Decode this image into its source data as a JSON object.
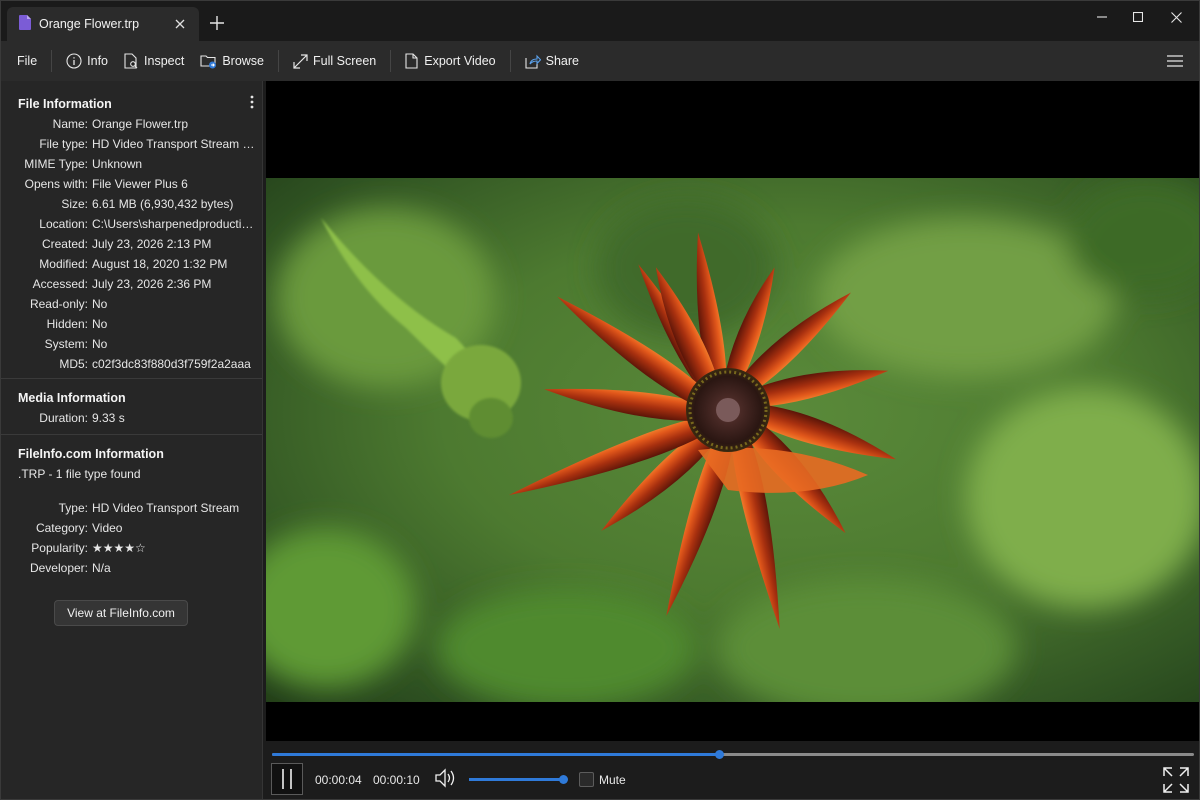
{
  "tab": {
    "title": "Orange Flower.trp"
  },
  "toolbar": {
    "file": "File",
    "info": "Info",
    "inspect": "Inspect",
    "browse": "Browse",
    "fullscreen": "Full Screen",
    "export": "Export Video",
    "share": "Share"
  },
  "file_info": {
    "heading": "File Information",
    "rows": [
      {
        "k": "Name:",
        "v": "Orange Flower.trp"
      },
      {
        "k": "File type:",
        "v": "HD Video Transport Stream (.trp)"
      },
      {
        "k": "MIME Type:",
        "v": "Unknown"
      },
      {
        "k": "Opens with:",
        "v": "File Viewer Plus 6"
      },
      {
        "k": "Size:",
        "v": "6.61 MB (6,930,432 bytes)"
      },
      {
        "k": "Location:",
        "v": "C:\\Users\\sharpenedproductions"
      },
      {
        "k": "Created:",
        "v": "July 23, 2026 2:13 PM"
      },
      {
        "k": "Modified:",
        "v": "August 18, 2020 1:32 PM"
      },
      {
        "k": "Accessed:",
        "v": "July 23, 2026 2:36 PM"
      },
      {
        "k": "Read-only:",
        "v": "No"
      },
      {
        "k": "Hidden:",
        "v": "No"
      },
      {
        "k": "System:",
        "v": "No"
      },
      {
        "k": "MD5:",
        "v": "c02f3dc83f880d3f759f2a2aaa"
      }
    ]
  },
  "media_info": {
    "heading": "Media Information",
    "rows": [
      {
        "k": "Duration:",
        "v": "9.33 s"
      }
    ]
  },
  "fileinfo_com": {
    "heading": "FileInfo.com Information",
    "summary": ".TRP - 1 file type found",
    "rows": [
      {
        "k": "Type:",
        "v": "HD Video Transport Stream"
      },
      {
        "k": "Category:",
        "v": "Video"
      },
      {
        "k": "Popularity:",
        "v": "★★★★☆"
      },
      {
        "k": "Developer:",
        "v": "N/a"
      }
    ],
    "button": "View at FileInfo.com"
  },
  "player": {
    "current_time": "00:00:04",
    "total_time": "00:00:10",
    "progress": 0.485,
    "volume": 1.0,
    "mute_label": "Mute",
    "muted": false
  },
  "colors": {
    "accent": "#2f7ad9",
    "background": "#1f1f1f",
    "panel": "#262626"
  }
}
